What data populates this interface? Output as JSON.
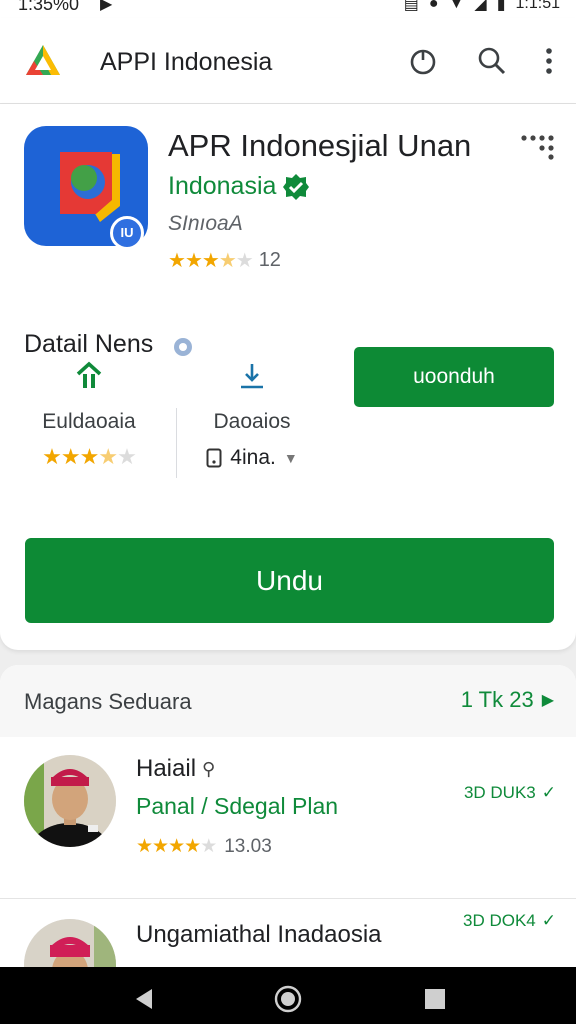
{
  "status_bar": {
    "time": "1:35%0",
    "right_time": "1:1:51"
  },
  "app_bar": {
    "title": "APPI Indonesia"
  },
  "app": {
    "name": "APR Indonesjial Unan",
    "developer": "Indonasia",
    "subtitle": "SInıoaA",
    "icon_badge": "IU",
    "rating_count": "12",
    "rating_stars": 3.5
  },
  "details": {
    "title": "Datail Nens",
    "stat1_label": "Euldaoaia",
    "stat1_stars": 3.5,
    "stat2_label": "Daoaios",
    "size_value": "4ina.",
    "small_button": "uoonduh",
    "big_button": "Undu"
  },
  "related": {
    "title": "Magans Seduara",
    "count": "1 Tk 23",
    "items": [
      {
        "name": "Haiail",
        "subtitle": "Panal / Sdegal Plan",
        "rating_count": "13.03",
        "rating_stars": 4,
        "size": "3D DUK3"
      },
      {
        "name": "Ungamiathal Inadaosia",
        "size": "3D DOK4"
      }
    ]
  },
  "colors": {
    "accent_green": "#0d8a35",
    "text_green": "#0f8a3a",
    "star": "#f2a600",
    "icon_blue": "#1e63d6"
  }
}
